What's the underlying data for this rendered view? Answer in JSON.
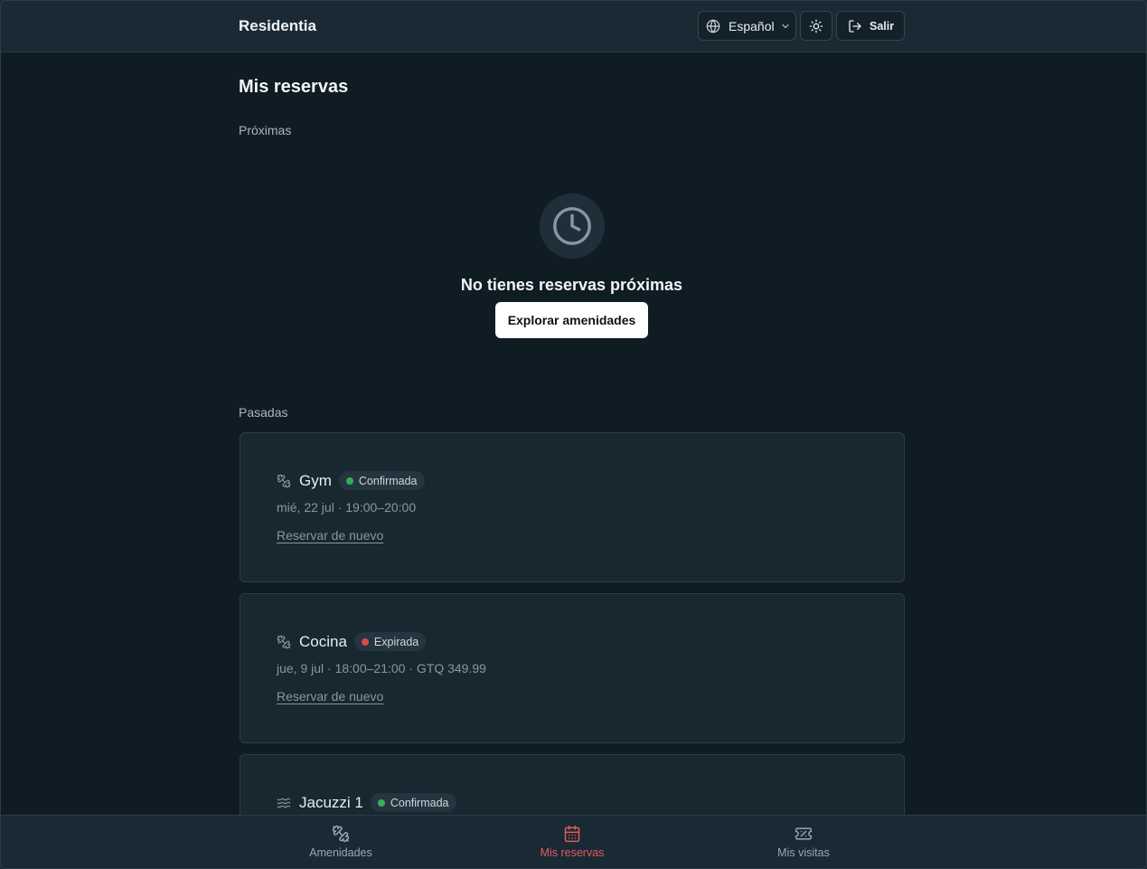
{
  "header": {
    "brand": "Residentia",
    "language": "Español",
    "logout_label": "Salir"
  },
  "page": {
    "title": "Mis reservas",
    "upcoming_label": "Próximas",
    "empty_title": "No tienes reservas próximas",
    "explore_button": "Explorar amenidades",
    "past_label": "Pasadas"
  },
  "reservations": [
    {
      "icon": "dumbbell-icon",
      "name": "Gym",
      "status": "Confirmada",
      "status_color": "#2fb15c",
      "meta": "mié, 22 jul · 19:00–20:00",
      "action": "Reservar de nuevo"
    },
    {
      "icon": "dumbbell-icon",
      "name": "Cocina",
      "status": "Expirada",
      "status_color": "#d9484c",
      "meta": "jue, 9 jul · 18:00–21:00 · GTQ 349.99",
      "action": "Reservar de nuevo"
    },
    {
      "icon": "waves-icon",
      "name": "Jacuzzi 1",
      "status": "Confirmada",
      "status_color": "#2fb15c",
      "meta": "",
      "action": ""
    }
  ],
  "bottom_nav": [
    {
      "icon": "dumbbell-icon",
      "label": "Amenidades",
      "active": false
    },
    {
      "icon": "calendar-icon",
      "label": "Mis reservas",
      "active": true
    },
    {
      "icon": "ticket-icon",
      "label": "Mis visitas",
      "active": false
    }
  ],
  "colors": {
    "background": "#0f1c24",
    "surface": "#1a2a34",
    "accent": "#e05a5e"
  }
}
